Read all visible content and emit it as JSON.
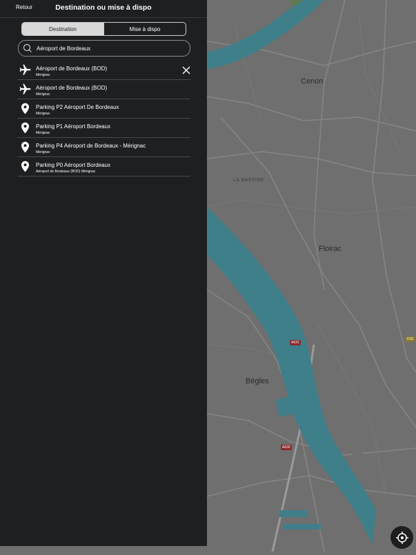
{
  "header": {
    "back_label": "Retour",
    "title": "Destination ou mise à dispo"
  },
  "tabs": [
    {
      "label": "Destination",
      "selected": true
    },
    {
      "label": "Mise à dispo",
      "selected": false
    }
  ],
  "search": {
    "value": "Aéroport de Bordeaux",
    "icon": "search-icon"
  },
  "results": [
    {
      "name": "Aéroport de Bordeaux (BOD)",
      "sub": "Mérignac",
      "icon": "airplane-icon"
    },
    {
      "name": "Aéroport de Bordeaux (BOD)",
      "sub": "Mérignac",
      "icon": "airplane-icon"
    },
    {
      "name": "Parking P2 Aéroport De Bordeaux",
      "sub": "Mérignac",
      "icon": "map-pin-icon"
    },
    {
      "name": "Parking P1 Aéroport Bordeaux",
      "sub": "Mérignac",
      "icon": "map-pin-icon"
    },
    {
      "name": "Parking P4 Aéroport de Bordeaux - Mérignac",
      "sub": "Mérignac",
      "icon": "map-pin-icon"
    },
    {
      "name": "Parking P0 Aéroport Bordeaux",
      "sub": "Aéroport de Bordeaux (BOD) Mérignac",
      "icon": "map-pin-icon"
    }
  ],
  "map": {
    "places": {
      "cenon": "Cenon",
      "floirac": "Floirac",
      "begles": "Bègles",
      "la_bastide": "LA BASTIDE"
    },
    "road_tags": {
      "a631": "A631",
      "a630": "A630",
      "d10": "D10"
    },
    "colors": {
      "river": "#3f7f8a",
      "land": "#6f6f6f",
      "road": "#8a8a8a"
    }
  },
  "colors": {
    "panel_bg": "#1e1f21",
    "segment_active": "#d9d9d9",
    "text": "#ffffff"
  }
}
